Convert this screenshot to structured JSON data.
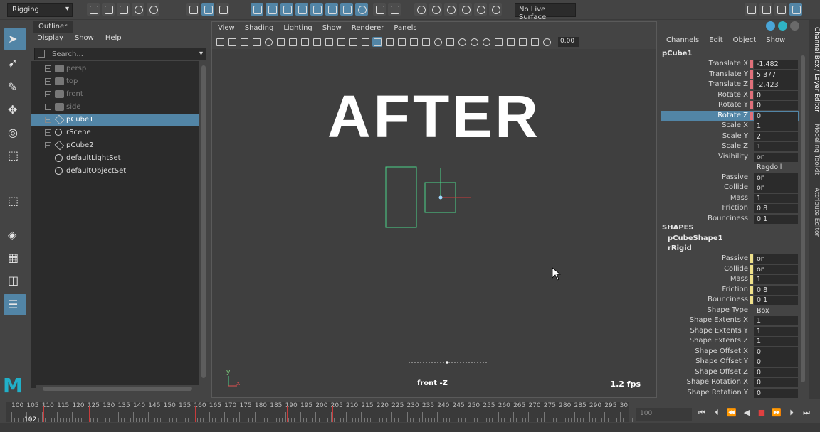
{
  "toolbar": {
    "mode": "Rigging",
    "live_surface": "No Live Surface"
  },
  "outliner": {
    "tab": "Outliner",
    "menus": [
      "Display",
      "Show",
      "Help"
    ],
    "search_placeholder": "Search...",
    "items": [
      {
        "label": "persp",
        "icon": "camera-icon",
        "dim": true,
        "selected": false
      },
      {
        "label": "top",
        "icon": "camera-icon",
        "dim": true,
        "selected": false
      },
      {
        "label": "front",
        "icon": "camera-icon",
        "dim": true,
        "selected": false
      },
      {
        "label": "side",
        "icon": "camera-icon",
        "dim": true,
        "selected": false
      },
      {
        "label": "pCube1",
        "icon": "mesh-icon",
        "dim": false,
        "selected": true
      },
      {
        "label": "rScene",
        "icon": "scene-icon",
        "dim": false,
        "selected": false
      },
      {
        "label": "pCube2",
        "icon": "mesh-icon",
        "dim": false,
        "selected": false
      },
      {
        "label": "defaultLightSet",
        "icon": "set-icon",
        "dim": false,
        "selected": false
      },
      {
        "label": "defaultObjectSet",
        "icon": "set-icon",
        "dim": false,
        "selected": false
      }
    ]
  },
  "viewport": {
    "menus": [
      "View",
      "Shading",
      "Lighting",
      "Show",
      "Renderer",
      "Panels"
    ],
    "value": "0.00",
    "overlay_title": "AFTER",
    "camera_label": "front -Z",
    "fps": "1.2 fps",
    "axis_y": "y",
    "axis_x": "x"
  },
  "channelbox": {
    "menus": [
      "Channels",
      "Edit",
      "Object",
      "Show"
    ],
    "object": "pCube1",
    "rows": [
      {
        "label": "Translate X",
        "value": "-1.482",
        "key": "#e0707a"
      },
      {
        "label": "Translate Y",
        "value": "5.377",
        "key": "#e0707a"
      },
      {
        "label": "Translate Z",
        "value": "-2.423",
        "key": "#e0707a"
      },
      {
        "label": "Rotate X",
        "value": "0",
        "key": "#e0707a"
      },
      {
        "label": "Rotate Y",
        "value": "0",
        "key": "#e0707a"
      },
      {
        "label": "Rotate Z",
        "value": "0",
        "key": "#e0707a",
        "selected": true
      },
      {
        "label": "Scale X",
        "value": "1",
        "key": ""
      },
      {
        "label": "Scale Y",
        "value": "2",
        "key": ""
      },
      {
        "label": "Scale Z",
        "value": "1",
        "key": ""
      },
      {
        "label": "Visibility",
        "value": "on",
        "key": ""
      },
      {
        "label": "",
        "value": "Ragdoll",
        "key": "",
        "noframe": true
      },
      {
        "label": "Passive",
        "value": "on",
        "key": ""
      },
      {
        "label": "Collide",
        "value": "on",
        "key": ""
      },
      {
        "label": "Mass",
        "value": "1",
        "key": ""
      },
      {
        "label": "Friction",
        "value": "0.8",
        "key": ""
      },
      {
        "label": "Bounciness",
        "value": "0.1",
        "key": ""
      }
    ],
    "shapes_heading": "SHAPES",
    "shape_name": "pCubeShape1",
    "rigid_name": "rRigid",
    "rigid_rows": [
      {
        "label": "Passive",
        "value": "on",
        "key": "#eee08a"
      },
      {
        "label": "Collide",
        "value": "on",
        "key": "#eee08a"
      },
      {
        "label": "Mass",
        "value": "1",
        "key": "#eee08a"
      },
      {
        "label": "Friction",
        "value": "0.8",
        "key": "#eee08a"
      },
      {
        "label": "Bounciness",
        "value": "0.1",
        "key": "#eee08a"
      },
      {
        "label": "Shape Type",
        "value": "Box",
        "key": "",
        "noframe": true
      },
      {
        "label": "Shape Extents X",
        "value": "1",
        "key": ""
      },
      {
        "label": "Shape Extents Y",
        "value": "1",
        "key": ""
      },
      {
        "label": "Shape Extents Z",
        "value": "1",
        "key": ""
      },
      {
        "label": "Shape Offset X",
        "value": "0",
        "key": ""
      },
      {
        "label": "Shape Offset Y",
        "value": "0",
        "key": ""
      },
      {
        "label": "Shape Offset Z",
        "value": "0",
        "key": ""
      },
      {
        "label": "Shape Rotation X",
        "value": "0",
        "key": ""
      },
      {
        "label": "Shape Rotation Y",
        "value": "0",
        "key": ""
      }
    ]
  },
  "side_tabs": [
    "Channel Box / Layer Editor",
    "Modeling Toolkit",
    "Attribute Editor"
  ],
  "timeline": {
    "ticks": [
      "100",
      "105",
      "110",
      "115",
      "120",
      "125",
      "130",
      "135",
      "140",
      "145",
      "150",
      "155",
      "160",
      "165",
      "170",
      "175",
      "180",
      "185",
      "190",
      "195",
      "200",
      "205",
      "210",
      "215",
      "220",
      "225",
      "230",
      "235",
      "240",
      "245",
      "250",
      "255",
      "260",
      "265",
      "270",
      "275",
      "280",
      "285",
      "290",
      "295",
      "30"
    ],
    "current_frame": "102",
    "end_field": "100"
  },
  "colors": {
    "accent": "#5285a6",
    "key_red": "#e0707a",
    "key_yellow": "#eee08a",
    "logo": "#21b0c8"
  }
}
